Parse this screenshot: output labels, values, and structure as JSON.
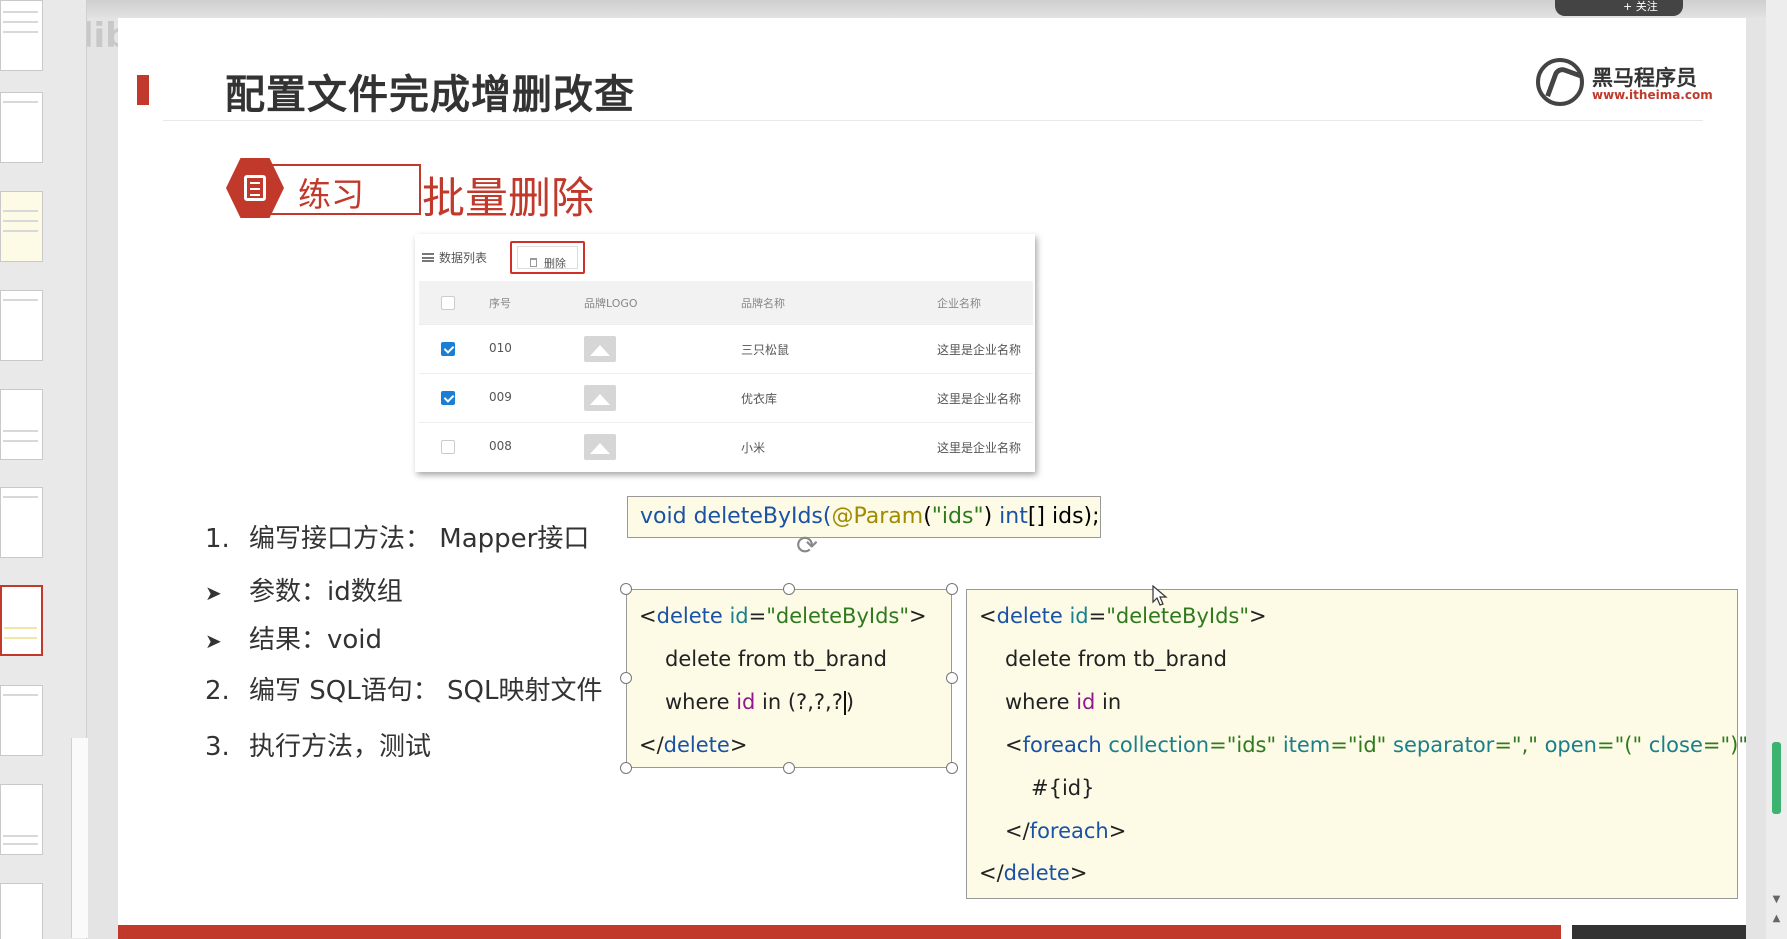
{
  "slide": {
    "title": "配置文件完成增删改查",
    "logo": {
      "name": "黑马程序员",
      "url": "www.itheima.com"
    },
    "exercise_label": "练习",
    "section_title": "批量删除"
  },
  "table_screenshot": {
    "list_label": "数据列表",
    "delete_label": "删除",
    "columns": [
      "序号",
      "品牌LOGO",
      "品牌名称",
      "企业名称"
    ],
    "rows": [
      {
        "checked": true,
        "id": "010",
        "brand": "三只松鼠",
        "company": "这里是企业名称"
      },
      {
        "checked": true,
        "id": "009",
        "brand": "优衣库",
        "company": "这里是企业名称"
      },
      {
        "checked": false,
        "id": "008",
        "brand": "小米",
        "company": "这里是企业名称"
      }
    ]
  },
  "steps": {
    "s1_num": "1.",
    "s1_text": "编写接口方法：  Mapper接口",
    "b1_text": "参数：id数组",
    "b2_text": "结果：void",
    "s2_num": "2.",
    "s2_text": "编写 SQL语句：  SQL映射文件",
    "s3_num": "3.",
    "s3_text": "执行方法，测试"
  },
  "code_signature": {
    "void": "void",
    "method": "deleteByIds(",
    "annotation": "@Param",
    "paren_open": "(",
    "str_ids": "\"ids\"",
    "paren_close": ") ",
    "int": "int",
    "rest": "[] ids);"
  },
  "code_a": {
    "l1_open": "<",
    "l1_tag": "delete",
    "l1_attr": " id",
    "l1_eq": "=",
    "l1_val": "\"deleteByIds\"",
    "l1_close": ">",
    "l2": "delete from tb_brand",
    "l3_where": "where ",
    "l3_id": "id",
    "l3_rest": " in (?,?,?",
    "l3_end": ")",
    "l4_open": "</",
    "l4_tag": "delete",
    "l4_close": ">"
  },
  "code_b": {
    "l1_open": "<",
    "l1_tag": "delete",
    "l1_attr": " id",
    "l1_eq": "=",
    "l1_val": "\"deleteByIds\"",
    "l1_close": ">",
    "l2": "delete from tb_brand",
    "l3_where": "where ",
    "l3_id": "id",
    "l3_rest": " in",
    "l4_open": "<",
    "l4_tag": "foreach",
    "l4_a1": " collection",
    "l4_v1": "=\"ids\"",
    "l4_a2": " item",
    "l4_v2": "=\"id\"",
    "l4_a3": " separator",
    "l4_v3": "=\",\"",
    "l4_a4": " open",
    "l4_v4": "=\"(\"",
    "l4_a5": " close",
    "l4_v5": "=\")\"",
    "l4_close": ">",
    "l5": "#{id}",
    "l6_open": "</",
    "l6_tag": "foreach",
    "l6_close": ">",
    "l7_open": "</",
    "l7_tag": "delete",
    "l7_close": ">"
  },
  "colors": {
    "accent": "#c0392b",
    "code_bg": "#fdfbe6",
    "keyword": "#1a52a6",
    "string": "#2f7a1f"
  }
}
